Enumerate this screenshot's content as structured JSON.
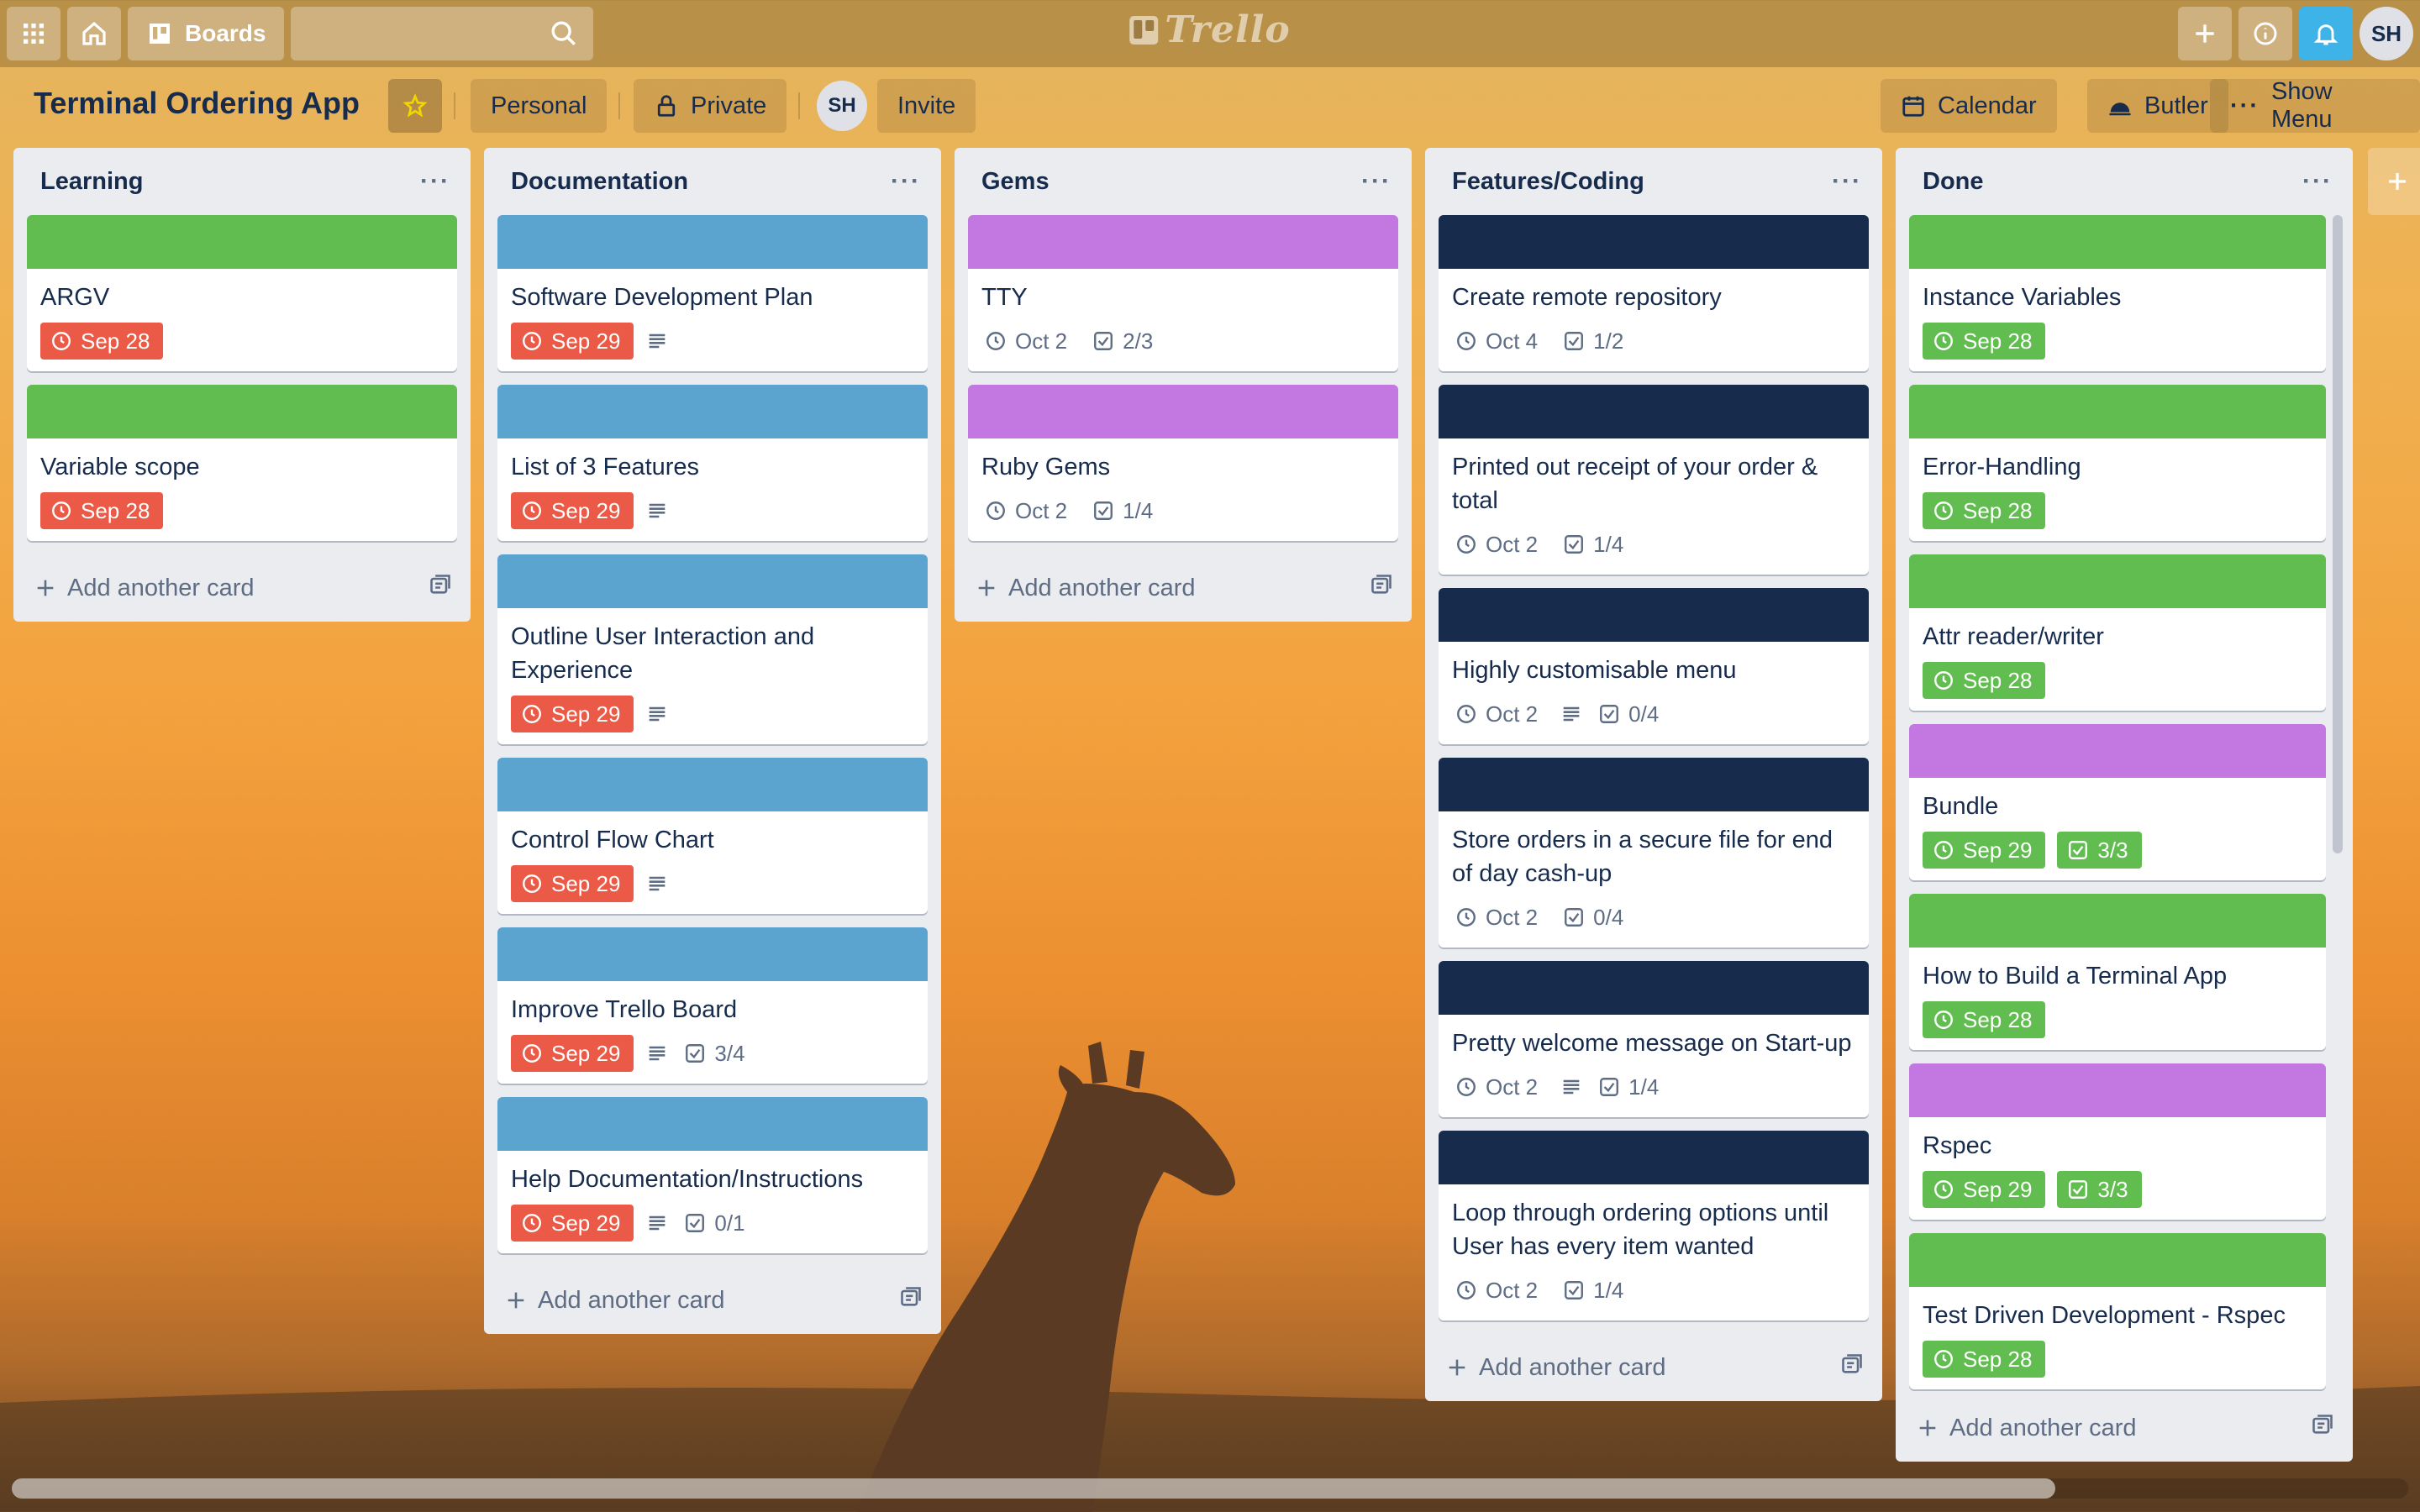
{
  "topbar": {
    "boards_label": "Boards",
    "search_placeholder": "",
    "logo_text": "Trello",
    "avatar_initials": "SH"
  },
  "board": {
    "title": "Terminal Ordering App",
    "visibility_team": "Personal",
    "visibility": "Private",
    "member_initials": "SH",
    "invite_label": "Invite",
    "calendar_label": "Calendar",
    "butler_label": "Butler",
    "show_menu_label": "Show Menu"
  },
  "colors": {
    "green": "#61bd4f",
    "blue": "#5ba4cf",
    "purple": "#c377e0",
    "navy": "#172b4d",
    "overdue": "#eb5a46"
  },
  "add_card_label": "Add another card",
  "lists": [
    {
      "title": "Learning",
      "cards": [
        {
          "label": "green",
          "title": "ARGV",
          "due": "Sep 28",
          "due_state": "overdue",
          "desc": false,
          "checklist": null
        },
        {
          "label": "green",
          "title": "Variable scope",
          "due": "Sep 28",
          "due_state": "overdue",
          "desc": false,
          "checklist": null
        }
      ]
    },
    {
      "title": "Documentation",
      "cards": [
        {
          "label": "blue",
          "title": "Software Development Plan",
          "due": "Sep 29",
          "due_state": "overdue",
          "desc": true,
          "checklist": null
        },
        {
          "label": "blue",
          "title": "List of 3 Features",
          "due": "Sep 29",
          "due_state": "overdue",
          "desc": true,
          "checklist": null
        },
        {
          "label": "blue",
          "title": "Outline User Interaction and Experience",
          "due": "Sep 29",
          "due_state": "overdue",
          "desc": true,
          "checklist": null
        },
        {
          "label": "blue",
          "title": "Control Flow Chart",
          "due": "Sep 29",
          "due_state": "overdue",
          "desc": true,
          "checklist": null
        },
        {
          "label": "blue",
          "title": "Improve Trello Board",
          "due": "Sep 29",
          "due_state": "overdue",
          "desc": true,
          "checklist": "3/4"
        },
        {
          "label": "blue",
          "title": "Help Documentation/Instructions",
          "due": "Sep 29",
          "due_state": "overdue",
          "desc": true,
          "checklist": "0/1"
        }
      ]
    },
    {
      "title": "Gems",
      "cards": [
        {
          "label": "purple",
          "title": "TTY",
          "due": "Oct 2",
          "due_state": "plain",
          "desc": false,
          "checklist": "2/3"
        },
        {
          "label": "purple",
          "title": "Ruby Gems",
          "due": "Oct 2",
          "due_state": "plain",
          "desc": false,
          "checklist": "1/4"
        }
      ]
    },
    {
      "title": "Features/Coding",
      "cards": [
        {
          "label": "navy",
          "title": "Create remote repository",
          "due": "Oct 4",
          "due_state": "plain",
          "desc": false,
          "checklist": "1/2"
        },
        {
          "label": "navy",
          "title": "Printed out receipt of your order & total",
          "due": "Oct 2",
          "due_state": "plain",
          "desc": false,
          "checklist": "1/4"
        },
        {
          "label": "navy",
          "title": "Highly customisable menu",
          "due": "Oct 2",
          "due_state": "plain",
          "desc": true,
          "checklist": "0/4"
        },
        {
          "label": "navy",
          "title": "Store orders in a secure file for end of day cash-up",
          "due": "Oct 2",
          "due_state": "plain",
          "desc": false,
          "checklist": "0/4"
        },
        {
          "label": "navy",
          "title": "Pretty welcome message on Start-up",
          "due": "Oct 2",
          "due_state": "plain",
          "desc": true,
          "checklist": "1/4"
        },
        {
          "label": "navy",
          "title": "Loop through ordering options until User has every item wanted",
          "due": "Oct 2",
          "due_state": "plain",
          "desc": false,
          "checklist": "1/4"
        }
      ]
    },
    {
      "title": "Done",
      "cards": [
        {
          "label": "green",
          "title": "Instance Variables",
          "due": "Sep 28",
          "due_state": "complete",
          "desc": false,
          "checklist": null
        },
        {
          "label": "green",
          "title": "Error-Handling",
          "due": "Sep 28",
          "due_state": "complete",
          "desc": false,
          "checklist": null
        },
        {
          "label": "green",
          "title": "Attr reader/writer",
          "due": "Sep 28",
          "due_state": "complete",
          "desc": false,
          "checklist": null
        },
        {
          "label": "purple",
          "title": "Bundle",
          "due": "Sep 29",
          "due_state": "complete",
          "desc": false,
          "checklist": "3/3",
          "checklist_done": true
        },
        {
          "label": "green",
          "title": "How to Build a Terminal App",
          "due": "Sep 28",
          "due_state": "complete",
          "desc": false,
          "checklist": null
        },
        {
          "label": "purple",
          "title": "Rspec",
          "due": "Sep 29",
          "due_state": "complete",
          "desc": false,
          "checklist": "3/3",
          "checklist_done": true
        },
        {
          "label": "green",
          "title": "Test Driven Development - Rspec",
          "due": "Sep 28",
          "due_state": "complete",
          "desc": false,
          "checklist": null
        },
        {
          "label": "green",
          "title": "",
          "due": "",
          "due_state": "none",
          "desc": false,
          "checklist": null
        }
      ]
    }
  ]
}
